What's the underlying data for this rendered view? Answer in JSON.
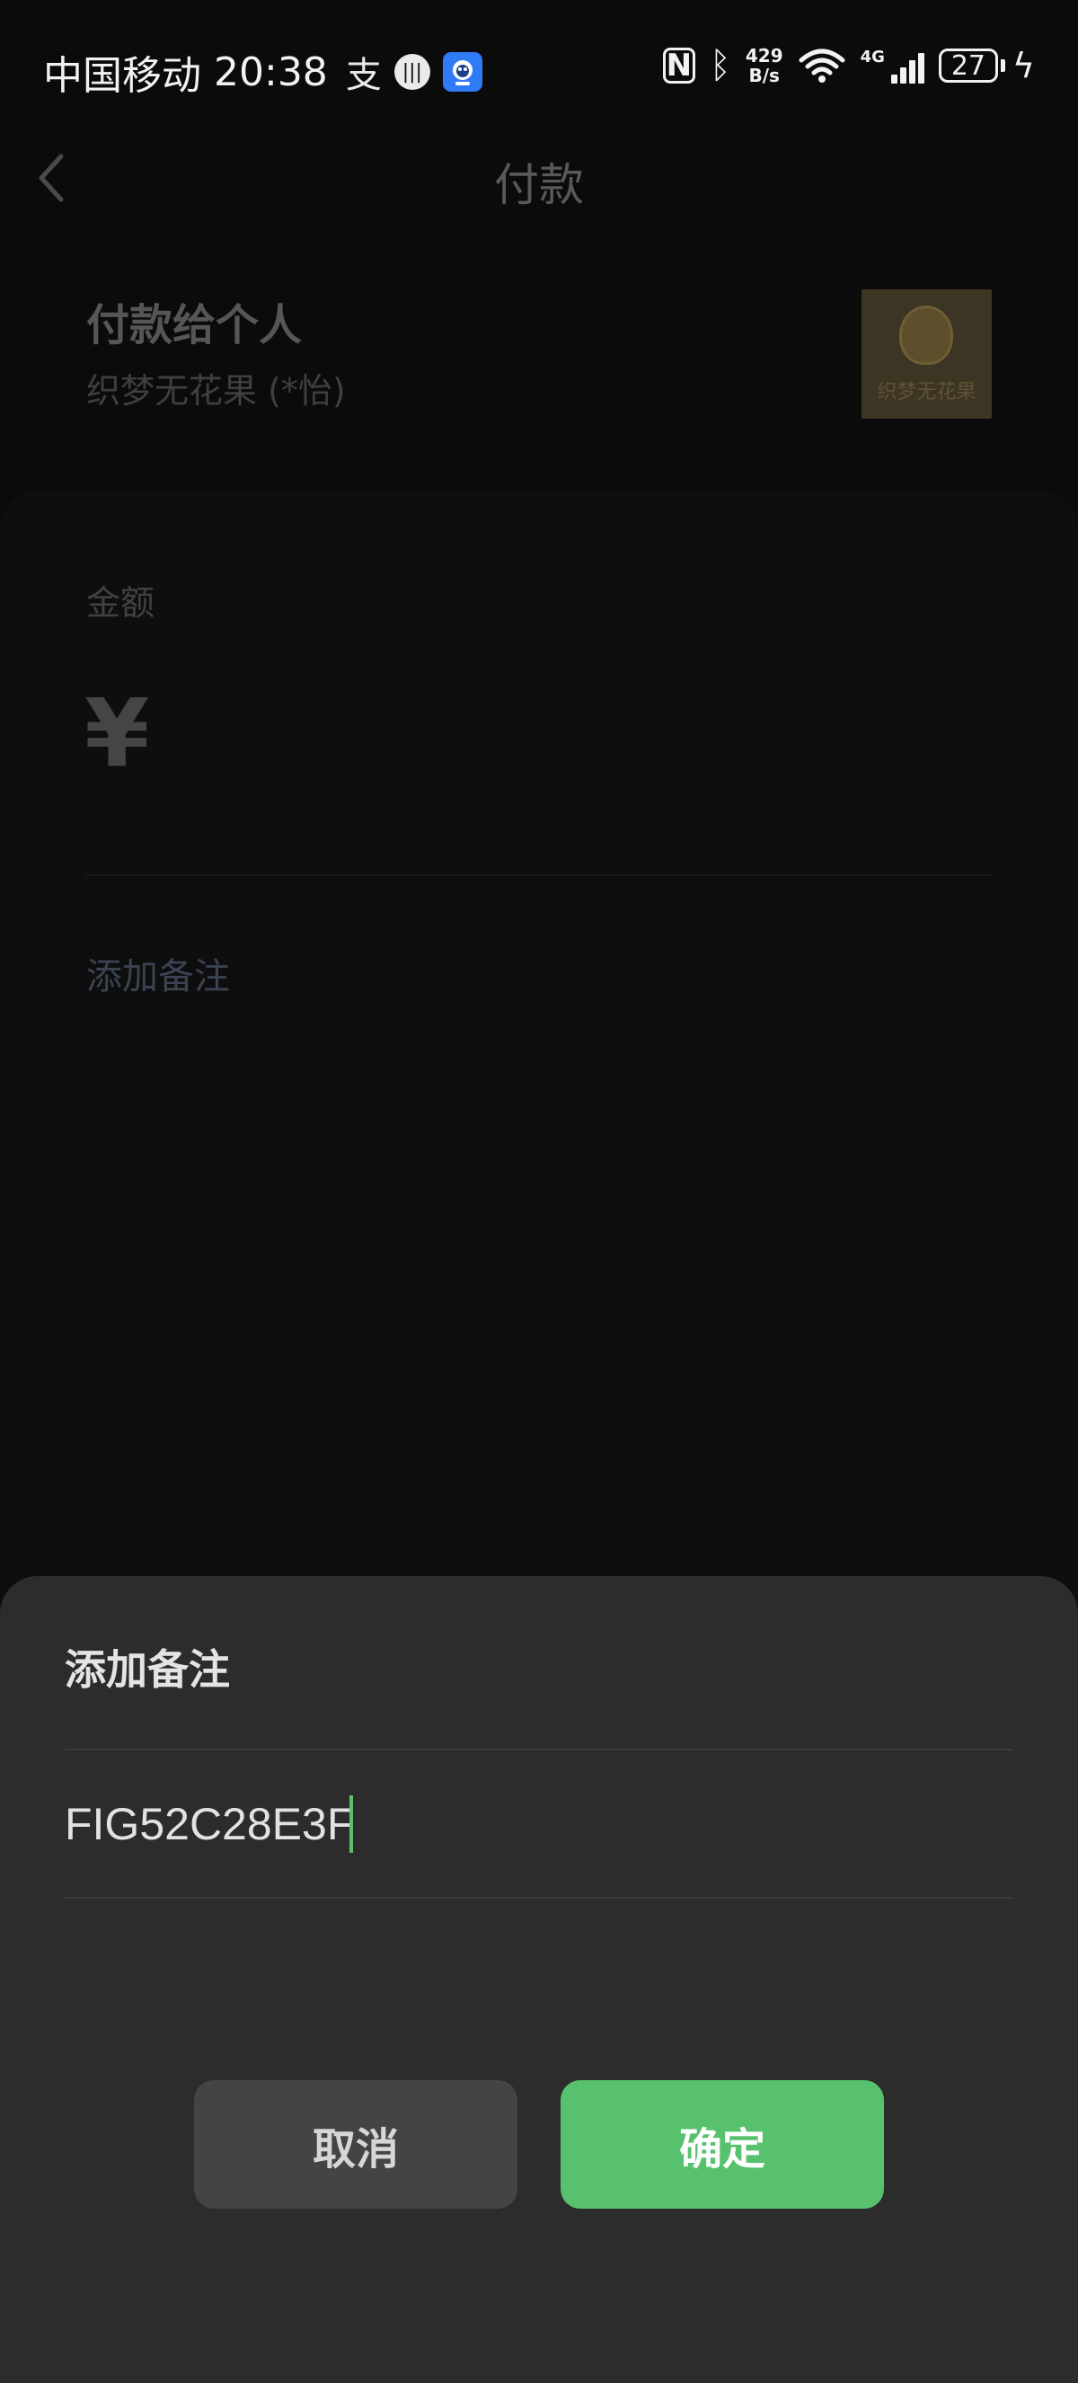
{
  "status_bar": {
    "carrier": "中国移动",
    "time": "20:38",
    "network_speed_value": "429",
    "network_speed_unit": "B/s",
    "cellular_label": "4G",
    "battery_level": "27",
    "icons": [
      "alipay-icon",
      "voice-assistant-icon",
      "app-notification-icon",
      "nfc-icon",
      "bluetooth-icon",
      "wifi-icon",
      "cellular-signal-icon",
      "battery-icon",
      "charging-icon"
    ]
  },
  "header": {
    "title": "付款",
    "back_icon": "chevron-left-icon"
  },
  "payee": {
    "title": "付款给个人",
    "name": "织梦无花果 (*怡)",
    "avatar_caption": "织梦无花果"
  },
  "amount": {
    "label": "金额",
    "currency_symbol": "¥",
    "add_note_link": "添加备注"
  },
  "note_sheet": {
    "title": "添加备注",
    "input_value": "FIG52C28E3F",
    "cancel_label": "取消",
    "confirm_label": "确定"
  },
  "colors": {
    "accent_green": "#57c16d",
    "sheet_bg": "#2c2c2c",
    "page_bg": "#0b0b0b"
  }
}
